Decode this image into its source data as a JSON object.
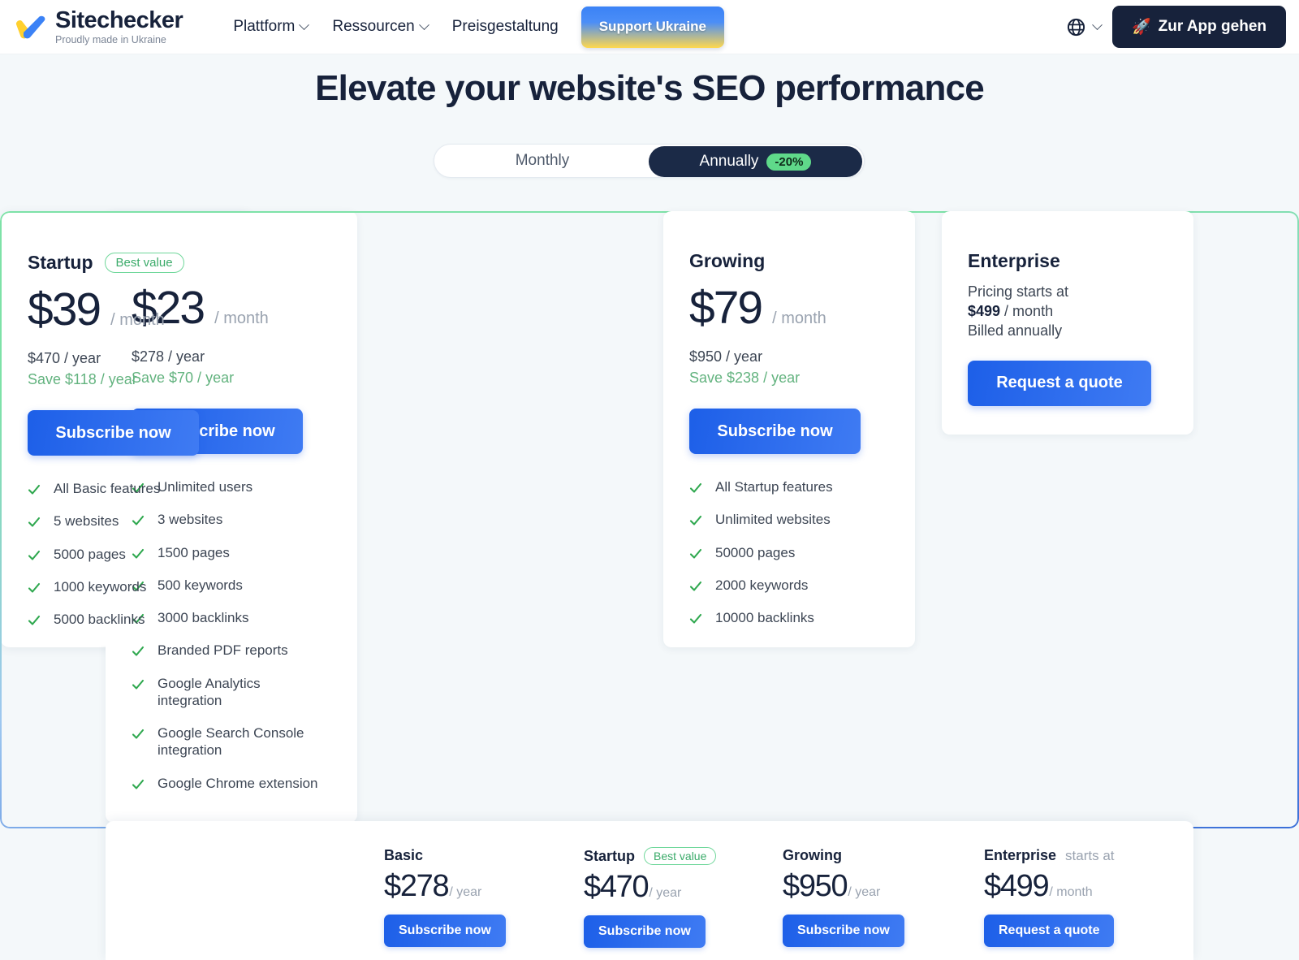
{
  "header": {
    "logo": {
      "name": "Sitechecker",
      "tagline": "Proudly made in Ukraine",
      "icon": "ukraine-check-icon"
    },
    "nav": [
      {
        "label": "Plattform",
        "has_dropdown": true
      },
      {
        "label": "Ressourcen",
        "has_dropdown": true
      },
      {
        "label": "Preisgestaltung",
        "has_dropdown": false
      }
    ],
    "support_button": {
      "label": "Support Ukraine"
    },
    "language": {
      "icon": "globe-icon",
      "chevron": "chevron-down-icon"
    },
    "app_button": {
      "label": "Zur App gehen",
      "icon": "rocket-icon"
    }
  },
  "hero": {
    "title": "Elevate your website's SEO performance"
  },
  "billing_toggle": {
    "monthly_label": "Monthly",
    "annually_label": "Annually",
    "discount_badge": "-20%",
    "active": "Annually"
  },
  "plans": [
    {
      "name": "Basic",
      "badge": "",
      "price": "$23",
      "per": "/ month",
      "year_price": "$278 / year",
      "save": "Save $70 / year",
      "cta": "Subscribe now",
      "features": [
        "Unlimited users",
        "3 websites",
        "1500 pages",
        "500 keywords",
        "3000 backlinks",
        "Branded PDF reports",
        "Google Analytics integration",
        "Google Search Console integration",
        "Google Chrome extension"
      ]
    },
    {
      "name": "Startup",
      "badge": "Best value",
      "price": "$39",
      "per": "/ month",
      "year_price": "$470 / year",
      "save": "Save $118 / year",
      "cta": "Subscribe now",
      "features": [
        "All Basic features",
        "5 websites",
        "5000 pages",
        "1000 keywords",
        "5000 backlinks"
      ]
    },
    {
      "name": "Growing",
      "badge": "",
      "price": "$79",
      "per": "/ month",
      "year_price": "$950 / year",
      "save": "Save $238 / year",
      "cta": "Subscribe now",
      "features": [
        "All Startup features",
        "Unlimited websites",
        "50000 pages",
        "2000 keywords",
        "10000 backlinks"
      ]
    }
  ],
  "enterprise": {
    "name": "Enterprise",
    "line1": "Pricing starts at",
    "price": "$499",
    "price_per": " / month",
    "line3": "Billed annually",
    "cta": "Request a quote"
  },
  "sticky_bar": {
    "items": [
      {
        "name": "Basic",
        "sub": "",
        "badge": "",
        "price": "$278",
        "per": "/ year",
        "cta": "Subscribe now"
      },
      {
        "name": "Startup",
        "sub": "",
        "badge": "Best value",
        "price": "$470",
        "per": "/ year",
        "cta": "Subscribe now"
      },
      {
        "name": "Growing",
        "sub": "",
        "badge": "",
        "price": "$950",
        "per": "/ year",
        "cta": "Subscribe now"
      },
      {
        "name": "Enterprise",
        "sub": "starts at",
        "badge": "",
        "price": "$499",
        "per": "/ month",
        "cta": "Request a quote"
      }
    ]
  },
  "colors": {
    "accent_blue": "#1d5fe8",
    "dark_navy": "#17223b",
    "green": "#63b37f",
    "badge_green": "#5fd98a",
    "page_bg": "#f4f8fa"
  }
}
